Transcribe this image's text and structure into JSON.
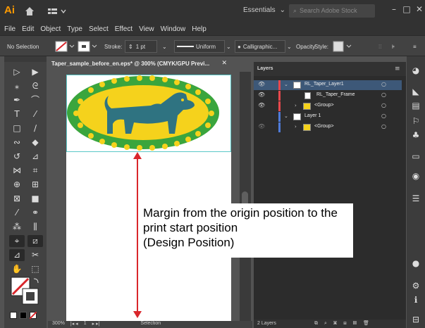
{
  "app": {
    "logo": "Ai",
    "workspace": "Essentials",
    "search_placeholder": "Search Adobe Stock",
    "minimize": "–",
    "maximize": "□",
    "close": "✕"
  },
  "menu": [
    "File",
    "Edit",
    "Object",
    "Type",
    "Select",
    "Effect",
    "View",
    "Window",
    "Help"
  ],
  "control_bar": {
    "selection": "No Selection",
    "stroke_label": "Stroke:",
    "stroke_value": "1 pt",
    "profile": "Uniform",
    "brush": "Calligraphic...",
    "opacity_label": "Opacity",
    "style_label": "Style:"
  },
  "document": {
    "tab_title": "Taper_sample_before_en.eps* @ 300% (CMYK/GPU Previ...",
    "zoom": "300%",
    "artboard_nav": "1",
    "selection_status": "Selection"
  },
  "layers_panel": {
    "title": "Layers",
    "rows": [
      {
        "name": "RL_Taper_Layer1",
        "bar_color": "#e8484d"
      },
      {
        "name": "RL_Taper_Frame",
        "bar_color": "#e8484d"
      },
      {
        "name": "<Group>",
        "bar_color": "#e8484d"
      },
      {
        "name": "Layer 1",
        "bar_color": "#4f7bd9"
      },
      {
        "name": "<Group>",
        "bar_color": "#4f7bd9"
      }
    ],
    "footer": "2 Layers"
  },
  "callout": {
    "line1": "Margin from the origin position to the",
    "line2": "print start position",
    "line3": "(Design Position)"
  },
  "colors": {
    "accent_red": "#d9262b",
    "dog_teal": "#2f7381",
    "oval_yellow": "#f5d21c",
    "oval_green": "#3aa53d"
  }
}
